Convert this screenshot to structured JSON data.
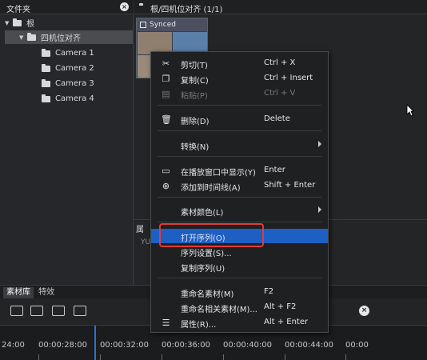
{
  "left_panel": {
    "title": "文件夹",
    "tree": [
      {
        "label": "根"
      },
      {
        "label": "四机位对齐"
      },
      {
        "label": "Camera 1"
      },
      {
        "label": "Camera 2"
      },
      {
        "label": "Camera 3"
      },
      {
        "label": "Camera 4"
      }
    ]
  },
  "right_panel": {
    "title": "根/四机位对齐 (1/1)",
    "thumbnail_label": "Synced Sequence",
    "props_title": "属",
    "props_sub": "YU"
  },
  "context_menu": {
    "items": [
      {
        "label": "剪切(T)",
        "shortcut": "Ctrl + X",
        "icon": "scissors-icon"
      },
      {
        "label": "复制(C)",
        "shortcut": "Ctrl + Insert",
        "icon": "copy-icon"
      },
      {
        "label": "粘贴(P)",
        "shortcut": "Ctrl + V",
        "icon": "paste-icon"
      },
      {
        "label": "删除(D)",
        "shortcut": "Delete",
        "icon": "trash-icon"
      },
      {
        "label": "转换(N)",
        "shortcut": ""
      },
      {
        "label": "在播放窗口中显示(Y)",
        "shortcut": "Enter",
        "icon": "monitor-icon"
      },
      {
        "label": "添加到时间线(A)",
        "shortcut": "Shift + Enter",
        "icon": "add-timeline-icon"
      },
      {
        "label": "素材颜色(L)",
        "shortcut": ""
      },
      {
        "label": "打开序列(O)",
        "shortcut": ""
      },
      {
        "label": "序列设置(S)...",
        "shortcut": ""
      },
      {
        "label": "复制序列(U)",
        "shortcut": ""
      },
      {
        "label": "重命名素材(M)",
        "shortcut": "F2"
      },
      {
        "label": "重命名相关素材(M)...",
        "shortcut": "Alt + F2"
      },
      {
        "label": "属性(R)...",
        "shortcut": "Alt + Enter",
        "icon": "list-icon"
      }
    ]
  },
  "tabs": [
    "素材库",
    "特效"
  ],
  "timeline": {
    "labels": [
      "24:00",
      "00:00:28:00",
      "00:00:32:00",
      "00:00:36:00",
      "00:00:40:00",
      "00:00:44:00",
      "00:00"
    ]
  },
  "colors": {
    "highlight": "#1e5fc4",
    "annotation_box": "#e33a3a"
  }
}
